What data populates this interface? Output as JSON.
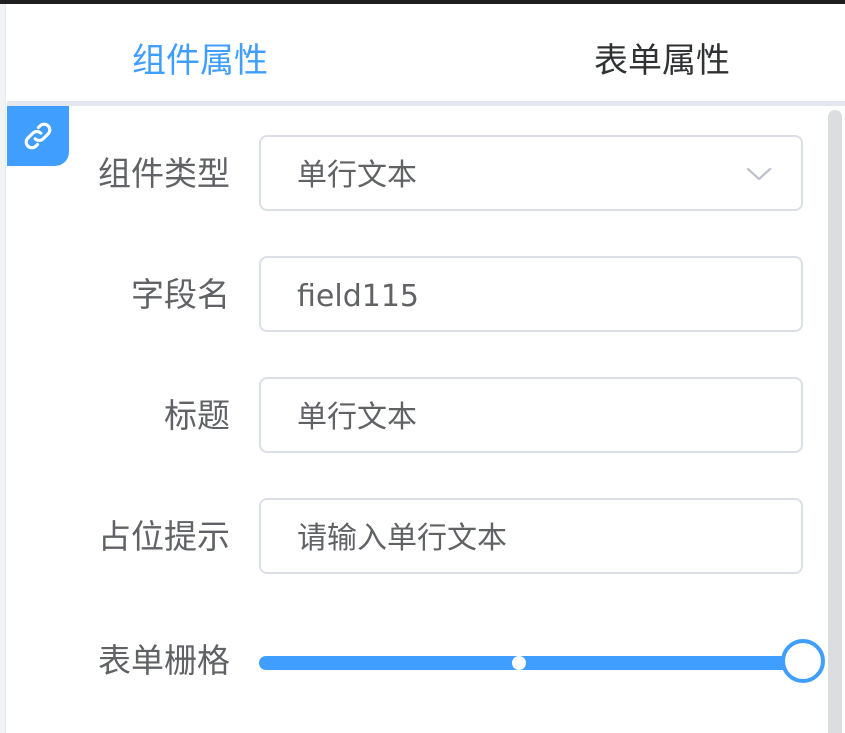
{
  "tabs": [
    {
      "label": "组件属性",
      "active": true
    },
    {
      "label": "表单属性",
      "active": false
    }
  ],
  "form": {
    "component_type": {
      "label": "组件类型",
      "value": "单行文本"
    },
    "field_name": {
      "label": "字段名",
      "value": "field115"
    },
    "title": {
      "label": "标题",
      "value": "单行文本"
    },
    "placeholder": {
      "label": "占位提示",
      "value": "请输入单行文本"
    },
    "grid": {
      "label": "表单栅格",
      "value_fraction": 1.0
    }
  },
  "colors": {
    "accent": "#409eff",
    "text": "#606266",
    "border": "#dcdfe6"
  },
  "icons": {
    "link_badge": "link-icon",
    "select_arrow": "chevron-down-icon"
  }
}
